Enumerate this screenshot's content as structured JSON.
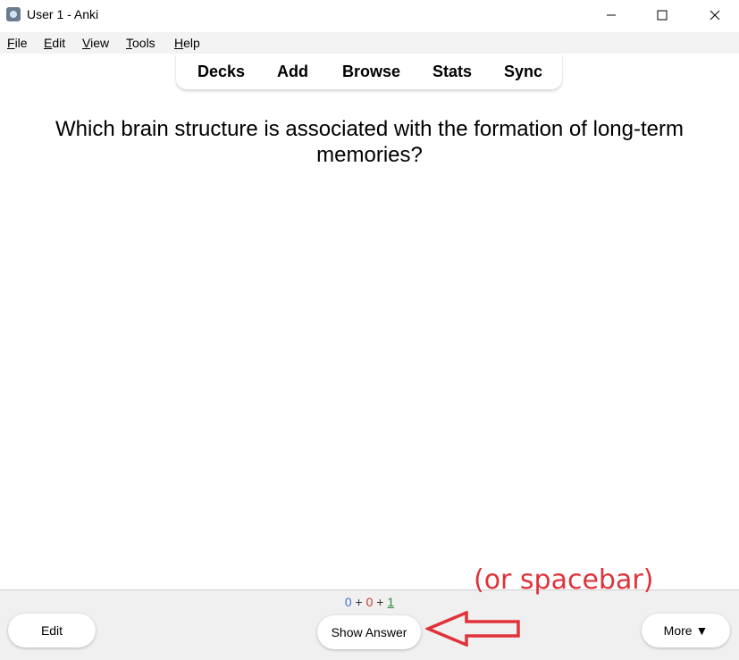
{
  "window": {
    "title": "User 1 - Anki",
    "controls": {
      "minimize_icon": "minimize-icon",
      "maximize_icon": "maximize-icon",
      "close_icon": "close-icon"
    }
  },
  "menubar": {
    "items": [
      {
        "mnemonic": "F",
        "rest": "ile"
      },
      {
        "mnemonic": "E",
        "rest": "dit"
      },
      {
        "mnemonic": "V",
        "rest": "iew"
      },
      {
        "mnemonic": "T",
        "rest": "ools"
      },
      {
        "mnemonic": "H",
        "rest": "elp"
      }
    ]
  },
  "toolbar": {
    "items": [
      "Decks",
      "Add",
      "Browse",
      "Stats",
      "Sync"
    ]
  },
  "card": {
    "question": "Which brain structure is associated with the formation of long-term memories?"
  },
  "counts": {
    "new": "0",
    "plus1": "+",
    "learning": "0",
    "plus2": "+",
    "review": "1",
    "colors": {
      "new": "#3a72d8",
      "learning": "#c33a2f",
      "review": "#2b8a3e"
    }
  },
  "buttons": {
    "edit": "Edit",
    "show_answer": "Show Answer",
    "more": "More ▼"
  },
  "annotation": {
    "text": "(or spacebar)",
    "color": "#e0323a"
  }
}
